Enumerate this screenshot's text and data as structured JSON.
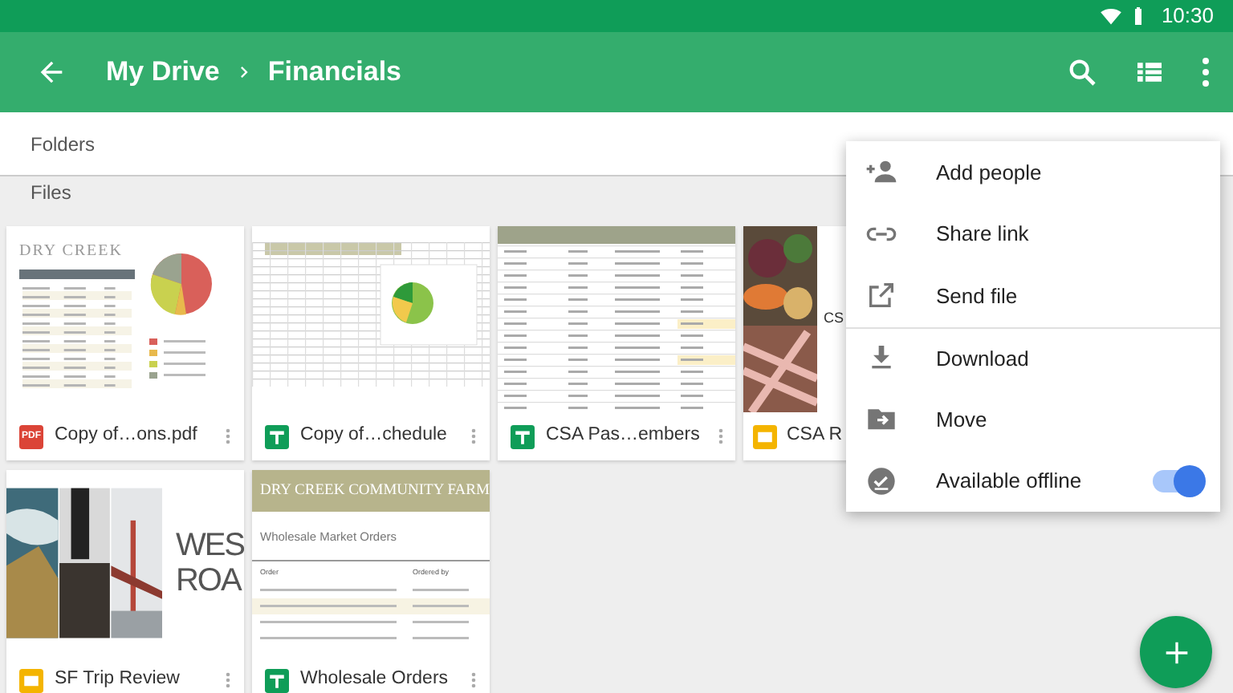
{
  "status_bar": {
    "time": "10:30"
  },
  "app_bar": {
    "breadcrumb": [
      "My Drive",
      "Financials"
    ]
  },
  "sections": {
    "folders": "Folders",
    "files": "Files"
  },
  "files": [
    {
      "name": "Copy of…ons.pdf",
      "kind": "pdf",
      "type_label": "PDF",
      "more_button": true,
      "thumbnail": {
        "kind": "report",
        "texts": [
          "DRY CREEK"
        ]
      }
    },
    {
      "name": "Copy of…chedule",
      "kind": "sheet",
      "more_button": true,
      "thumbnail": {
        "kind": "spreadsheet"
      }
    },
    {
      "name": "CSA Pas…embers",
      "kind": "sheet",
      "more_button": true,
      "thumbnail": {
        "kind": "table"
      }
    },
    {
      "name": "CSA R",
      "kind": "slides",
      "more_button": false,
      "thumbnail": {
        "kind": "photo-title",
        "texts": [
          "CS"
        ]
      }
    },
    {
      "name": "SF Trip Review",
      "kind": "slides",
      "more_button": true,
      "thumbnail": {
        "kind": "photo-title",
        "texts": [
          "WES",
          "ROA"
        ]
      }
    },
    {
      "name": "Wholesale Orders",
      "kind": "sheet",
      "more_button": true,
      "thumbnail": {
        "kind": "orders",
        "texts": [
          "DRY CREEK COMMUNITY FARM",
          "Wholesale Market Orders",
          "Order",
          "Ordered by"
        ]
      }
    }
  ],
  "menu": [
    {
      "label": "Add people",
      "divider_before": false
    },
    {
      "label": "Share link",
      "divider_before": false
    },
    {
      "label": "Send file",
      "divider_before": false
    },
    {
      "label": "Download",
      "divider_before": true
    },
    {
      "label": "Move",
      "divider_before": false
    },
    {
      "label": "Available offline",
      "divider_before": false,
      "kind": "toggle",
      "on": true
    }
  ]
}
